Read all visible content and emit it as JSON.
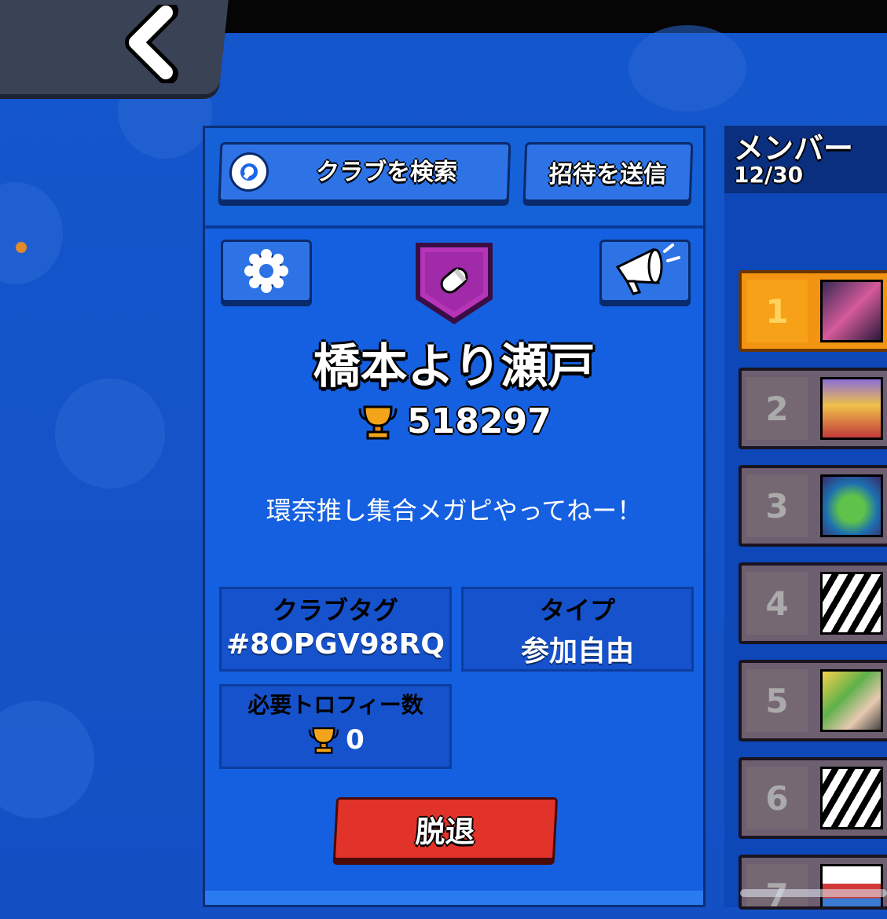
{
  "back": {
    "icon": "chevron-left-icon"
  },
  "toolbar": {
    "search_label": "クラブを検索",
    "search_icon": "search-icon",
    "invite_label": "招待を送信"
  },
  "club": {
    "settings_icon": "gear-icon",
    "badge_icon": "club-badge-icon",
    "announce_icon": "megaphone-icon",
    "name": "橋本より瀬戸",
    "trophies": "518297",
    "description": "環奈推し集合メガピやってねー！"
  },
  "info": {
    "tag_label": "クラブタグ",
    "tag_value": "#8OPGV98RQ",
    "type_label": "タイプ",
    "type_value": "参加自由",
    "req_label": "必要トロフィー数",
    "req_value": "0"
  },
  "leave_label": "脱退",
  "members": {
    "title": "メンバー",
    "count": "12/30",
    "ranks": [
      "1",
      "2",
      "3",
      "4",
      "5",
      "6",
      "7"
    ]
  },
  "colors": {
    "background": "#1553c9",
    "panel": "#1560e0",
    "leave_button": "#e2332a",
    "first_rank": "#f29412",
    "rank_row": "#6d5e70"
  }
}
